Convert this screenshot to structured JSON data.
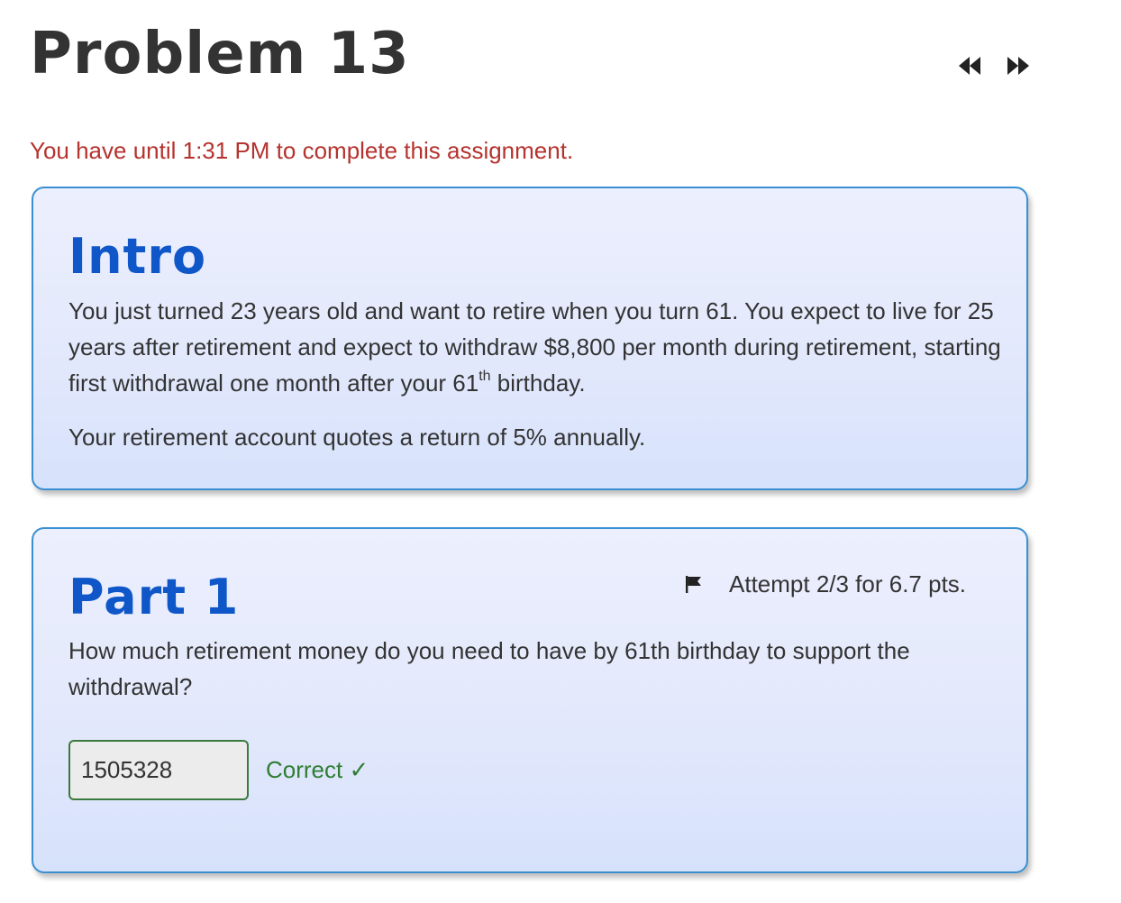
{
  "page": {
    "title": "Problem 13",
    "deadline": "You have until 1:31 PM to complete this assignment."
  },
  "nav": {
    "prev_icon": "rewind-icon",
    "next_icon": "fast-forward-icon"
  },
  "intro": {
    "heading": "Intro",
    "para1_a": "You just turned 23 years old and want to retire when you turn 61. You expect to live for 25 years after retirement and expect to withdraw $8,800 per month during retirement, starting first withdrawal one month after your 61",
    "para1_sup": "th",
    "para1_b": " birthday.",
    "para2": "Your retirement account quotes a return of 5% annually."
  },
  "part1": {
    "heading": "Part 1",
    "attempt": "Attempt 2/3 for 6.7 pts.",
    "flag_icon": "flag-icon",
    "question": "How much retirement money do you need to have by 61th birthday to support the withdrawal?",
    "answer_value": "1505328",
    "feedback": "Correct ✓"
  },
  "colors": {
    "deadline": "#b5332e",
    "heading": "#0f57c9",
    "correct": "#2f7d32",
    "card_border": "#3a8fd1"
  }
}
